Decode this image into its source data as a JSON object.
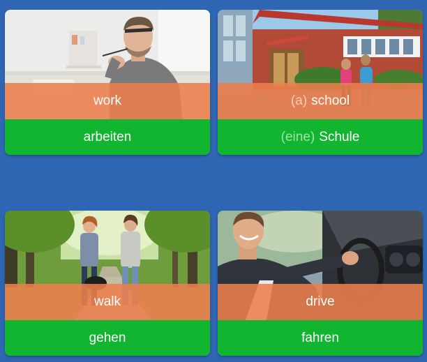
{
  "cards": [
    {
      "image": "man-working-at-desk-photo",
      "source": {
        "article": "",
        "word": "work"
      },
      "target": {
        "article": "",
        "word": "arbeiten"
      }
    },
    {
      "image": "school-building-with-children-photo",
      "source": {
        "article": "(a)",
        "word": "school"
      },
      "target": {
        "article": "(eine)",
        "word": "Schule"
      }
    },
    {
      "image": "women-walking-dog-in-park-photo",
      "source": {
        "article": "",
        "word": "walk"
      },
      "target": {
        "article": "",
        "word": "gehen"
      }
    },
    {
      "image": "man-driving-car-photo",
      "source": {
        "article": "",
        "word": "drive"
      },
      "target": {
        "article": "",
        "word": "fahren"
      }
    }
  ],
  "colors": {
    "background": "#2f66b3",
    "source_band": "#ec7e4c",
    "target_band": "#11b52f",
    "article_source": "#f7cdb7",
    "article_target": "#9fe1ab"
  }
}
